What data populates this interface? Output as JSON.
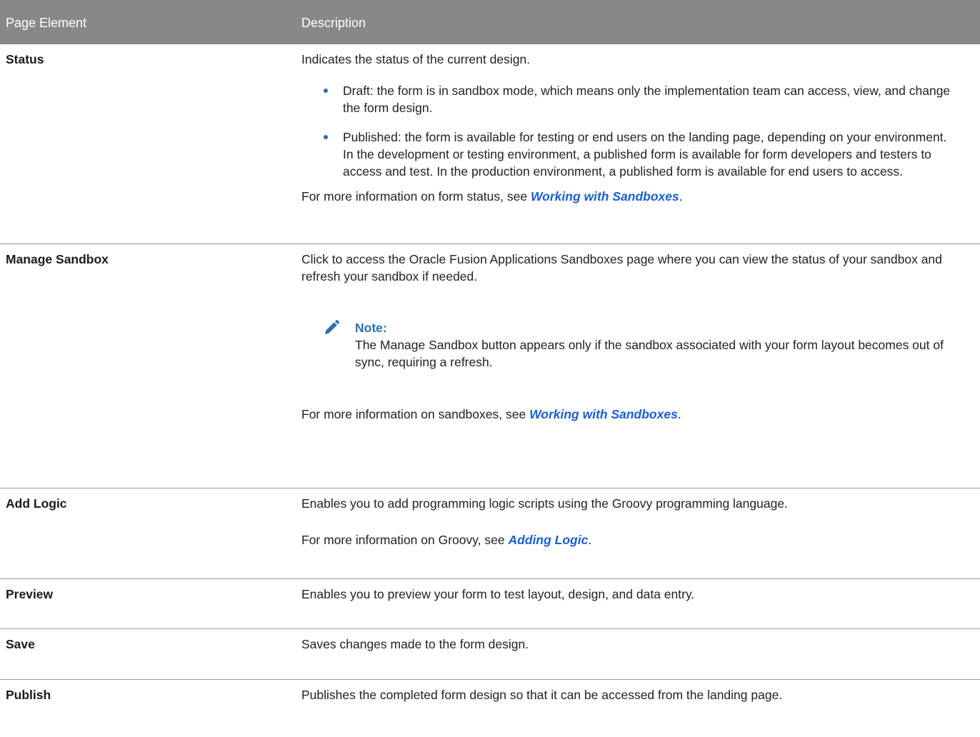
{
  "table": {
    "header": {
      "col_element": "Page Element",
      "col_description": "Description"
    },
    "rows": [
      {
        "element": "Status",
        "intro": "Indicates the status of the current design.",
        "bullets": [
          "Draft: the form is in sandbox mode, which means only the implementation team can access, view, and change the form design.",
          "Published: the form is available for testing or end users on the landing page, depending on your environment. In the development or testing environment, a published form is available for form developers and testers to access and test. In the production environment, a published form is available for end users to access."
        ],
        "more_prefix": "For more information on form status, see ",
        "more_link": "Working with Sandboxes",
        "more_suffix": "."
      },
      {
        "element": "Manage Sandbox",
        "intro": "Click to access the Oracle Fusion Applications Sandboxes page where you can view the status of your sandbox and refresh your sandbox if needed.",
        "note_title": "Note:",
        "note_body": "The Manage Sandbox button appears only if the sandbox associated with your form layout becomes out of sync, requiring a refresh.",
        "more_prefix": "For more information on sandboxes, see ",
        "more_link": "Working with Sandboxes",
        "more_suffix": "."
      },
      {
        "element": "Add Logic",
        "intro": "Enables you to add programming logic scripts using the Groovy programming language.",
        "more_prefix": "For more information on Groovy, see ",
        "more_link": "Adding Logic",
        "more_suffix": "."
      },
      {
        "element": "Preview",
        "intro": "Enables you to preview your form to test layout, design, and data entry."
      },
      {
        "element": "Save",
        "intro": "Saves changes made to the form design."
      },
      {
        "element": "Publish",
        "intro": "Publishes the completed form design so that it can be accessed from the landing page."
      }
    ]
  },
  "colors": {
    "header_bg": "#888888",
    "link": "#1a5fd0",
    "bullet": "#1f6fb5",
    "note_accent": "#2a6fb0"
  },
  "icons": {
    "note": "pencil-icon"
  }
}
